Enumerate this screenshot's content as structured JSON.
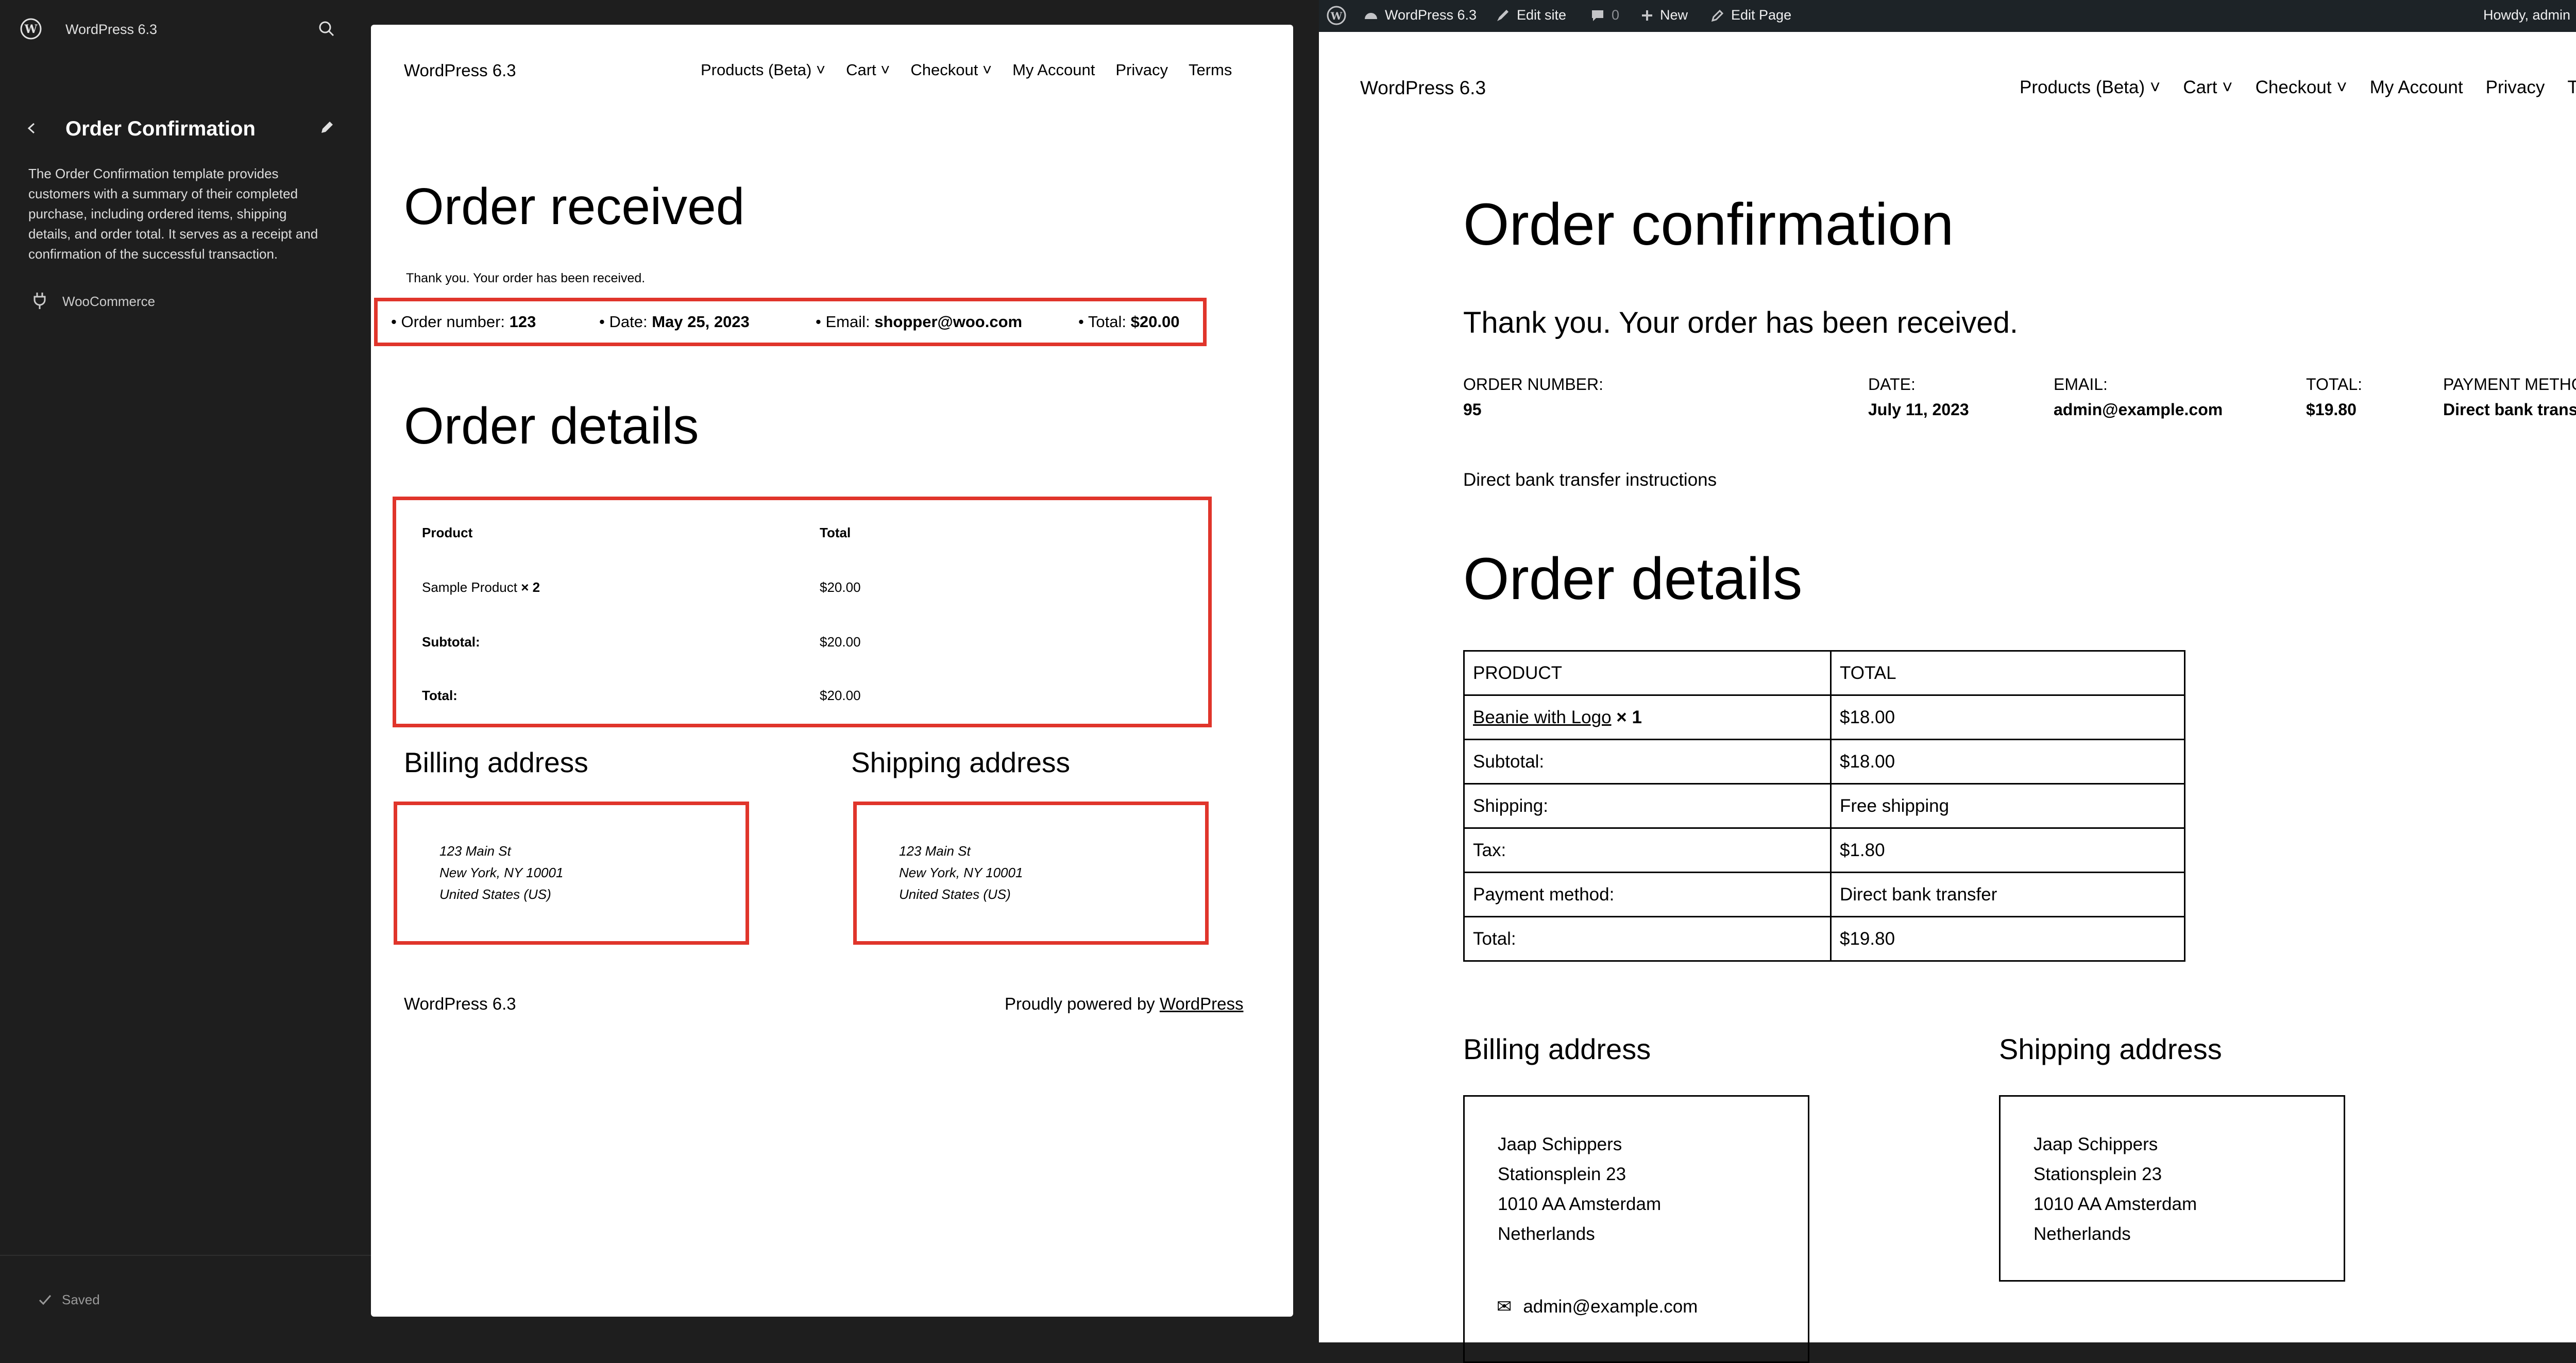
{
  "editor_sidebar": {
    "site_title": "WordPress 6.3",
    "template_title": "Order Confirmation",
    "template_description": "The Order Confirmation template provides customers with a summary of their completed purchase, including ordered items, shipping details, and order total. It serves as a receipt and confirmation of the successful transaction.",
    "plugin_label": "WooCommerce",
    "status": "Saved"
  },
  "editor_canvas": {
    "site_title": "WordPress 6.3",
    "nav": [
      "Products (Beta)",
      "Cart",
      "Checkout",
      "My Account",
      "Privacy",
      "Terms"
    ],
    "heading_received": "Order received",
    "thanks": "Thank you. Your order has been received.",
    "summary": {
      "order_number_label": "Order number:",
      "order_number": "123",
      "date_label": "Date:",
      "date": "May 25, 2023",
      "email_label": "Email:",
      "email": "shopper@woo.com",
      "total_label": "Total:",
      "total": "$20.00"
    },
    "heading_details": "Order details",
    "details": {
      "col_product": "Product",
      "col_total": "Total",
      "item_name": "Sample Product",
      "item_qty": "× 2",
      "item_total": "$20.00",
      "subtotal_label": "Subtotal:",
      "subtotal": "$20.00",
      "total_label": "Total:",
      "total": "$20.00"
    },
    "heading_billing": "Billing address",
    "heading_shipping": "Shipping address",
    "billing_lines": [
      "123 Main St",
      "New York, NY 10001",
      "United States (US)"
    ],
    "shipping_lines": [
      "123 Main St",
      "New York, NY 10001",
      "United States (US)"
    ],
    "footer_title": "WordPress 6.3",
    "footer_powered_prefix": "Proudly powered by ",
    "footer_powered_link": "WordPress"
  },
  "admin_bar": {
    "site_name": "WordPress 6.3",
    "edit_site": "Edit site",
    "comments_count": "0",
    "new_label": "New",
    "edit_page": "Edit Page",
    "howdy": "Howdy, admin"
  },
  "frontend": {
    "site_title": "WordPress 6.3",
    "nav": [
      "Products (Beta)",
      "Cart",
      "Checkout",
      "My Account",
      "Privacy",
      "Terms"
    ],
    "heading_confirmation": "Order confirmation",
    "thanks": "Thank you. Your order has been received.",
    "overview": [
      {
        "label": "Order number:",
        "value": "95"
      },
      {
        "label": "Date:",
        "value": "July 11, 2023"
      },
      {
        "label": "Email:",
        "value": "admin@example.com"
      },
      {
        "label": "Total:",
        "value": "$19.80"
      },
      {
        "label": "Payment method:",
        "value": "Direct bank transfer"
      }
    ],
    "instructions": "Direct bank transfer instructions",
    "heading_details": "Order details",
    "table": {
      "col_product": "PRODUCT",
      "col_total": "TOTAL",
      "item_name": "Beanie with Logo",
      "item_qty": "× 1",
      "item_total": "$18.00",
      "rows": [
        {
          "label": "Subtotal:",
          "value": "$18.00"
        },
        {
          "label": "Shipping:",
          "value": "Free shipping"
        },
        {
          "label": "Tax:",
          "value": "$1.80"
        },
        {
          "label": "Payment method:",
          "value": "Direct bank transfer"
        },
        {
          "label": "Total:",
          "value": "$19.80"
        }
      ]
    },
    "heading_billing": "Billing address",
    "heading_shipping": "Shipping address",
    "billing_lines": [
      "Jaap Schippers",
      "Stationsplein 23",
      "1010 AA Amsterdam",
      "Netherlands"
    ],
    "billing_email": "admin@example.com",
    "shipping_lines": [
      "Jaap Schippers",
      "Stationsplein 23",
      "1010 AA Amsterdam",
      "Netherlands"
    ]
  },
  "colors": {
    "highlight": "#e0352b",
    "sidebar_bg": "#1e1e1e",
    "adminbar_bg": "#1d2327"
  }
}
